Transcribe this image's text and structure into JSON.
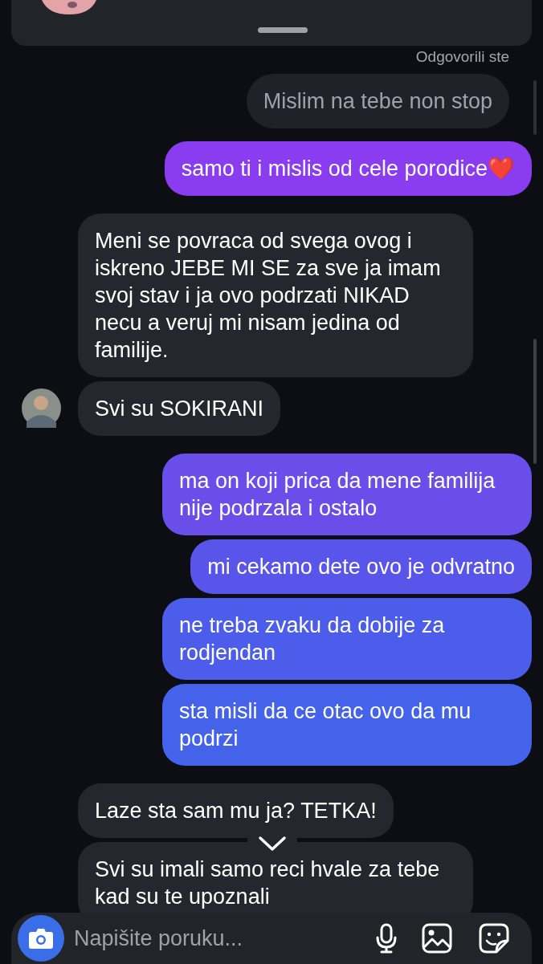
{
  "reply_label": "Odgovorili ste",
  "messages": [
    {
      "kind": "quote",
      "text": "Mislim na tebe non stop"
    },
    {
      "kind": "sent",
      "text": "samo ti i mislis od cele porodice❤️"
    },
    {
      "kind": "received",
      "text": "Meni se povraca od svega ovog i iskreno JEBE MI SE za sve ja imam svoj stav i ja ovo podrzati NIKAD necu a veruj mi nisam jedina od familije.",
      "avatar": false
    },
    {
      "kind": "received",
      "text": "Svi su SOKIRANI",
      "avatar": true
    },
    {
      "kind": "sent",
      "text": "ma on koji prica da mene familija nije podrzala i ostalo"
    },
    {
      "kind": "sent",
      "text": "mi cekamo dete ovo je odvratno"
    },
    {
      "kind": "sent",
      "text": "ne treba zvaku da dobije za rodjendan"
    },
    {
      "kind": "sent",
      "text": "sta misli da ce otac ovo da mu podrzi"
    },
    {
      "kind": "received",
      "text": "Laze sta sam mu ja? TETKA!",
      "avatar": false
    },
    {
      "kind": "received",
      "text": "Svi su imali samo reci hvale za tebe kad su te upoznali",
      "avatar": false
    }
  ],
  "composer": {
    "placeholder": "Napišite poruku..."
  }
}
